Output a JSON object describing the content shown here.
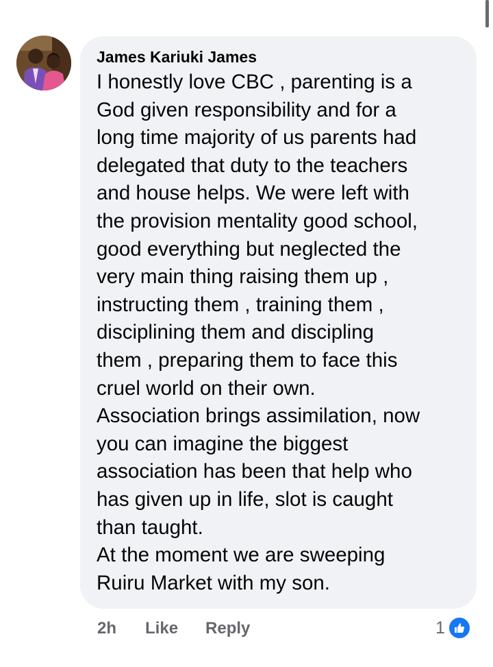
{
  "comment": {
    "author": "James Kariuki James",
    "lines": [
      "I honestly love CBC , parenting is a",
      "God given responsibility and for a",
      "long time majority of us parents had",
      "delegated that duty to the teachers",
      "and house helps. We were left with",
      "the provision mentality good school,",
      "good everything but neglected the",
      "very main thing raising them up ,",
      "instructing them , training them ,",
      "disciplining them and discipling",
      "them , preparing them to face this",
      "cruel world on their own.",
      "Association brings assimilation, now",
      "you can imagine the biggest",
      "association has been that help who",
      "has given up in life, slot is caught",
      "than taught.",
      "At the moment we are sweeping",
      "Ruiru Market with my son."
    ]
  },
  "actions": {
    "time": "2h",
    "like_label": "Like",
    "reply_label": "Reply"
  },
  "reactions": {
    "count": "1",
    "icon": "thumbs-up-icon",
    "badge_color": "#1877f2"
  },
  "theme": {
    "bubble_bg": "#f0f2f5",
    "text_color": "#050505",
    "meta_color": "#65676b"
  }
}
